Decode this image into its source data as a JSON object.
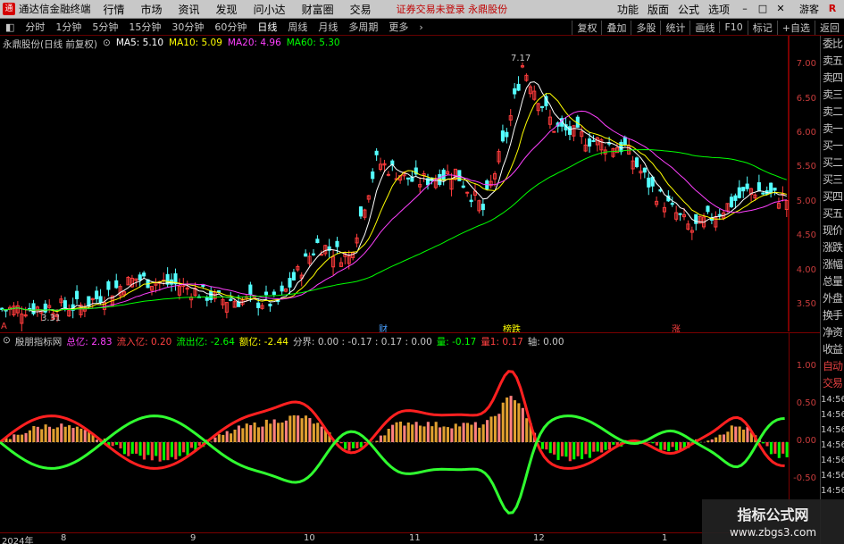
{
  "menubar": {
    "app_title": "通达信金融终端",
    "items": [
      "行情",
      "市场",
      "资讯",
      "发现",
      "问小达",
      "财富圈",
      "交易"
    ],
    "notice": "证券交易未登录  永鼎股份",
    "right_items": [
      "功能",
      "版面",
      "公式",
      "选项"
    ],
    "guest": "游客"
  },
  "periodbar": {
    "periods": [
      "分时",
      "1分钟",
      "5分钟",
      "15分钟",
      "30分钟",
      "60分钟",
      "日线",
      "周线",
      "月线",
      "多周期",
      "更多"
    ],
    "active": "日线",
    "tools": [
      "复权",
      "叠加",
      "多股",
      "统计",
      "画线",
      "F10",
      "标记",
      "+自选",
      "返回"
    ]
  },
  "main_chart": {
    "title": "永鼎股份(日线 前复权)",
    "ma": [
      {
        "label": "MA5: 5.10",
        "color": "#ffffff"
      },
      {
        "label": "MA10: 5.09",
        "color": "#ffff00"
      },
      {
        "label": "MA20: 4.96",
        "color": "#ff40ff"
      },
      {
        "label": "MA60: 5.30",
        "color": "#00ff00"
      }
    ],
    "yticks": [
      "7.00",
      "6.50",
      "6.00",
      "5.50",
      "5.00",
      "4.50",
      "4.00",
      "3.50"
    ],
    "high_label": "7.17",
    "low_label": "3.31",
    "markers": [
      {
        "text": "财",
        "color": "#4aa0ff"
      },
      {
        "text": "榜跌",
        "color": "#ffff00"
      },
      {
        "text": "涨",
        "color": "#ff4040"
      },
      {
        "text": "A",
        "color": "#ff4040"
      }
    ]
  },
  "sub_chart": {
    "name": "殷朋指标网",
    "values": [
      {
        "text": "总亿: 2.83",
        "color": "#ff40ff"
      },
      {
        "text": "流入亿: 0.20",
        "color": "#ff4040"
      },
      {
        "text": "流出亿: -2.64",
        "color": "#00ff00"
      },
      {
        "text": "额亿: -2.44",
        "color": "#ffff00"
      },
      {
        "text": "分界: 0.00 : -0.17 : 0.17 : 0.00",
        "color": "#c8c8c8"
      },
      {
        "text": "量: -0.17",
        "color": "#00ff00"
      },
      {
        "text": "量1: 0.17",
        "color": "#ff4040"
      },
      {
        "text": "轴: 0.00",
        "color": "#c8c8c8"
      }
    ],
    "yticks": [
      "1.00",
      "0.50",
      "0.00",
      "-0.50"
    ]
  },
  "right_panel": {
    "items": [
      "委比",
      "卖五",
      "卖四",
      "卖三",
      "卖二",
      "卖一",
      "买一",
      "买二",
      "买三",
      "买四",
      "买五",
      "现价",
      "涨跌",
      "涨幅",
      "总量",
      "外盘",
      "换手",
      "净资",
      "收益"
    ],
    "lower": [
      "自动",
      "交易"
    ],
    "times": [
      "14:56",
      "14:56",
      "14:56",
      "14:56",
      "14:56",
      "14:56",
      "14:56",
      "14:56"
    ]
  },
  "date_axis": [
    "2024年",
    "8",
    "9",
    "10",
    "11",
    "12",
    "1"
  ],
  "watermark": {
    "line1": "指标公式网",
    "line2": "www.zbgs3.com"
  }
}
